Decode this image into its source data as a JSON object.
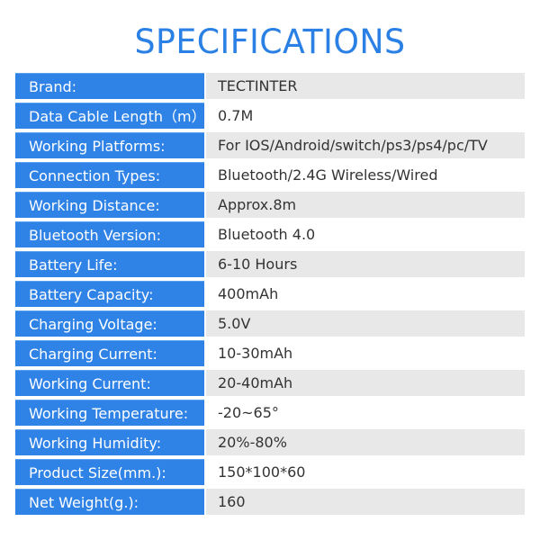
{
  "title": "SPECIFICATIONS",
  "colors": {
    "accent": "#2f82e6",
    "title": "#2a80e4",
    "row_shade": "#e8e8e8",
    "value_text": "#333333"
  },
  "specs": [
    {
      "label": "Brand:",
      "value": "TECTINTER"
    },
    {
      "label": "Data Cable Length（m）:",
      "value": "0.7M"
    },
    {
      "label": "Working Platforms:",
      "value": "For IOS/Android/switch/ps3/ps4/pc/TV"
    },
    {
      "label": "Connection Types:",
      "value": "Bluetooth/2.4G Wireless/Wired"
    },
    {
      "label": "Working Distance:",
      "value": "Approx.8m"
    },
    {
      "label": "Bluetooth Version:",
      "value": "Bluetooth 4.0"
    },
    {
      "label": "Battery Life:",
      "value": "6-10 Hours"
    },
    {
      "label": "Battery Capacity:",
      "value": "400mAh"
    },
    {
      "label": "Charging Voltage:",
      "value": "5.0V"
    },
    {
      "label": "Charging Current:",
      "value": "10-30mAh"
    },
    {
      "label": "Working Current:",
      "value": "20-40mAh"
    },
    {
      "label": "Working Temperature:",
      "value": "-20~65°"
    },
    {
      "label": "Working Humidity:",
      "value": "20%-80%"
    },
    {
      "label": "Product Size(mm.):",
      "value": "150*100*60"
    },
    {
      "label": "Net Weight(g.):",
      "value": "160"
    }
  ]
}
